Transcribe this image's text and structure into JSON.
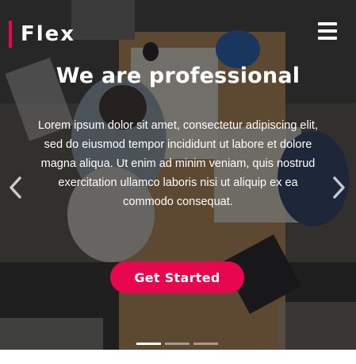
{
  "brand": {
    "name": "Flex",
    "accent_color": "#e8064f"
  },
  "hero": {
    "title": "We are professional",
    "description": "Lorem ipsum dolor sit amet, consectetur adipiscing elit, sed do eiusmod tempor incididunt ut labore et dolore magna aliqua. Ut enim ad minim veniam, quis nostrud exercitation ullamco laboris nisi ut aliquip ex ea commodo consequat.",
    "cta_label": "Get Started",
    "cta_color": "#e8064f"
  },
  "navigation": {
    "menu_icon": "hamburger-menu-icon",
    "prev_icon": "chevron-left-icon",
    "next_icon": "chevron-right-icon"
  },
  "carousel": {
    "slide_count": 3,
    "active_index": 0
  }
}
